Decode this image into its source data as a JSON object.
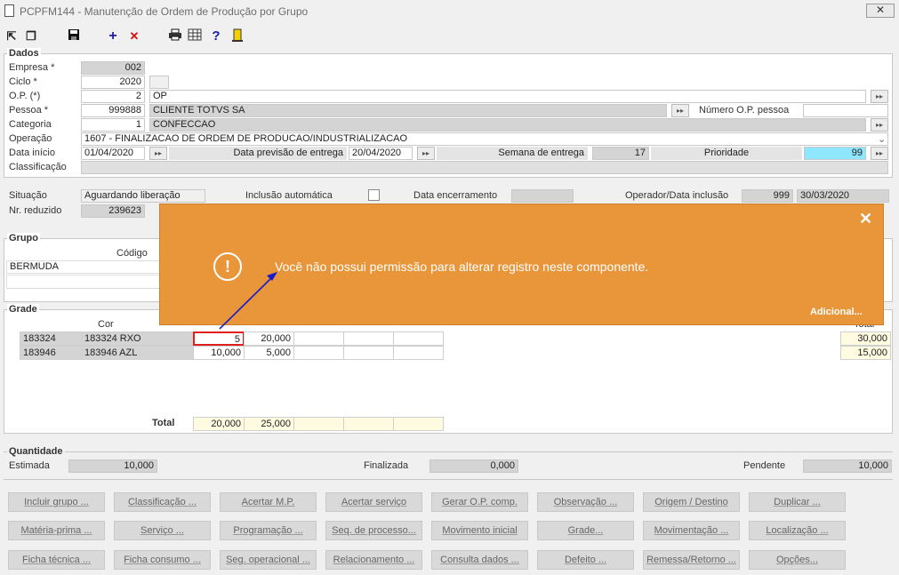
{
  "window": {
    "title": "PCPFM144 - Manutenção de Ordem de Produção por Grupo",
    "close": "✕"
  },
  "toolbar": {
    "plus": "+",
    "remove": "✕",
    "help": "?"
  },
  "dados": {
    "section": "Dados",
    "empresa": {
      "label": "Empresa *",
      "value": "002"
    },
    "ciclo": {
      "label": "Ciclo *",
      "value": "2020"
    },
    "op": {
      "label": "O.P. (*)",
      "value": "2",
      "desc": "OP"
    },
    "pessoa": {
      "label": "Pessoa *",
      "value": "999888",
      "desc": "CLIENTE TOTVS SA",
      "num_op_label": "Número O.P. pessoa"
    },
    "categoria": {
      "label": "Categoria",
      "value": "1",
      "desc": "CONFECCAO"
    },
    "operacao": {
      "label": "Operação",
      "value": "1607 - FINALIZACAO DE ORDEM DE PRODUCAO/INDUSTRIALIZACAO"
    },
    "data_inicio": {
      "label": "Data início",
      "value": "01/04/2020"
    },
    "data_previsao": {
      "label": "Data previsão de entrega",
      "value": "20/04/2020"
    },
    "semana": {
      "label": "Semana de entrega",
      "value": "17"
    },
    "prioridade": {
      "label": "Prioridade",
      "value": "99"
    },
    "classificacao": {
      "label": "Classificação"
    }
  },
  "status": {
    "situacao": {
      "label": "Situação",
      "value": "Aguardando liberação"
    },
    "inclusao": {
      "label": "Inclusão automática"
    },
    "encerramento": {
      "label": "Data encerramento"
    },
    "operador": {
      "label": "Operador/Data inclusão",
      "value": "999",
      "date": "30/03/2020"
    },
    "reduzido": {
      "label": "Nr. reduzido",
      "value": "239623"
    }
  },
  "grupo": {
    "section": "Grupo",
    "col_codigo": "Código",
    "value": "BERMUDA"
  },
  "grade": {
    "section": "Grade",
    "col_cor": "Cor",
    "col_total": "Total",
    "rows": [
      {
        "code": "183324",
        "name": "183324 RXO",
        "v1": "5",
        "v2": "20,000",
        "total": "30,000"
      },
      {
        "code": "183946",
        "name": "183946 AZL",
        "v1": "10,000",
        "v2": "5,000",
        "total": "15,000"
      }
    ],
    "total_label": "Total",
    "total1": "20,000",
    "total2": "25,000"
  },
  "quantidade": {
    "section": "Quantidade",
    "estimada_label": "Estimada",
    "estimada": "10,000",
    "finalizada_label": "Finalizada",
    "finalizada": "0,000",
    "pendente_label": "Pendente",
    "pendente": "10,000"
  },
  "buttons": [
    [
      "Incluir grupo ...",
      "Classificação ...",
      "Acertar M.P.",
      "Acertar serviço",
      "Gerar O.P. comp.",
      "Observação ...",
      "Origem / Destino",
      "Duplicar ..."
    ],
    [
      "Matéria-prima ...",
      "Serviço ...",
      "Programação ...",
      "Seq. de processo...",
      "Movimento inicial",
      "Grade...",
      "Movimentação ...",
      "Localização ..."
    ],
    [
      "Ficha técnica ...",
      "Ficha consumo ...",
      "Seg. operacional ...",
      "Relacionamento ...",
      "Consulta dados ...",
      "Defeito ...",
      "Remessa/Retorno ...",
      "Opções..."
    ]
  ],
  "toast": {
    "message": "Você não possui permissão para alterar registro neste componente.",
    "more": "Adicional...",
    "close": "✕",
    "icon": "!"
  },
  "colors": {
    "toast": "#e9963a",
    "highlight": "#e02020",
    "arrow": "#1a1acc"
  }
}
